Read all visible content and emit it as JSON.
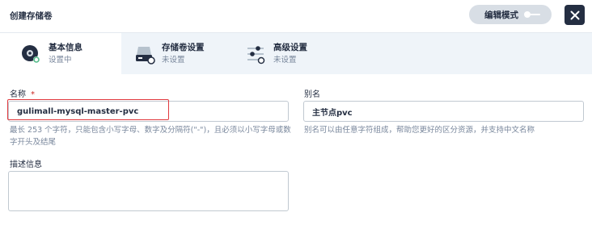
{
  "header": {
    "title": "创建存储卷",
    "edit_mode_label": "编辑模式"
  },
  "steps": [
    {
      "label": "基本信息",
      "status": "设置中",
      "icon": "disk-icon",
      "active": true
    },
    {
      "label": "存储卷设置",
      "status": "未设置",
      "icon": "storage-drive-icon",
      "active": false
    },
    {
      "label": "高级设置",
      "status": "未设置",
      "icon": "sliders-icon",
      "active": false
    }
  ],
  "form": {
    "name_label": "名称",
    "name_required_mark": "*",
    "name_value": "gulimall-mysql-master-pvc",
    "name_hint_line1": "最长 253 个字符，只能包含小写字母、数字及分隔符(\"-\")，且必须以小写字母或数",
    "name_hint_line2": "字开头及结尾",
    "alias_label": "别名",
    "alias_value": "主节点pvc",
    "alias_hint": "别名可以由任意字符组成，帮助您更好的区分资源，并支持中文名称",
    "description_label": "描述信息",
    "description_value": ""
  },
  "colors": {
    "dark": "#242e42",
    "muted": "#79879c",
    "step_bar_bg": "#eff4f9",
    "toggle_bg": "#d8dee5",
    "required": "#ca2621",
    "highlight": "#e0393e",
    "active_dot": "#55bc8a"
  }
}
